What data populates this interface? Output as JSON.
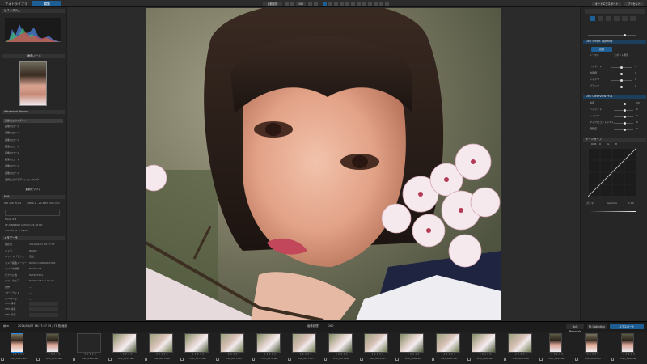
{
  "topbar": {
    "library_tab": "フォトライブラリ",
    "edit_tab": "編集",
    "compare_btn": "比較処理",
    "zoom_btn": "100",
    "sync_btn": "オートエクスポート",
    "right_btn": "プリセット"
  },
  "left": {
    "histogram_title": "ヒストグラム",
    "navigator_title": "画像ノート",
    "history_title": "Advanced History",
    "history_items": [
      "画像のエクスポート",
      "画像のロード",
      "画像のロード",
      "画像のロード",
      "画像のロード",
      "画像のロード",
      "画像のロード",
      "画像のロード",
      "画像のロード",
      "選択先のグラデーションマスク"
    ],
    "restore_btn": "最新をクリア",
    "exif_title": "Exif",
    "exif_top": [
      "ISO 100",
      "f/1.4",
      "1/800 s",
      "+0.3 EV",
      "105 mm"
    ],
    "exif_lines": [
      "Nikon Z 8",
      "AF-S NIKKOR 105mm f/1.4E ED",
      "ISO100 f/1.4 1/800s"
    ],
    "meta_title": "メタデータ",
    "meta_rows": [
      {
        "k": "撮影日",
        "v": "2024/04/07 16:17:57"
      },
      {
        "k": "カメラ",
        "v": "NIKON"
      },
      {
        "k": "ホワイトバランス",
        "v": "自動"
      },
      {
        "k": "カメラ製造メーカー",
        "v": "NIKON CORPORATION"
      },
      {
        "k": "カメラの種類",
        "v": "NIKON Z 8"
      },
      {
        "k": "ピクセル数",
        "v": "8256x5504"
      },
      {
        "k": "ソフトウェア",
        "v": "NIKON Z 8 Ver.02.00"
      },
      {
        "k": "著作",
        "v": "---"
      },
      {
        "k": "コピーライト",
        "v": "---"
      },
      {
        "k": "キーワード",
        "v": "---"
      }
    ],
    "iptc_rows": [
      "IPTC 情報",
      "IPTC 情報",
      "IPTC 情報"
    ],
    "bottom_label": "デフォルトに戻す"
  },
  "right": {
    "section1": "DxO Smart Lighting",
    "s1_mode": "自動",
    "s1_tab1": "ノーマル",
    "s1_tab2": "スポット測光",
    "s1_items": [
      {
        "label": "ハイライト",
        "value": "0"
      },
      {
        "label": "中間調",
        "value": "0"
      },
      {
        "label": "シャドウ",
        "value": "0"
      },
      {
        "label": "ブラック",
        "value": "0"
      }
    ],
    "section2": "DxO ClearView Plus",
    "s2_items": [
      {
        "label": "強度",
        "value": "50"
      },
      {
        "label": "ハイライト",
        "value": "0"
      },
      {
        "label": "シャドウ",
        "value": "0"
      },
      {
        "label": "マイクロコントラスト",
        "value": "0"
      },
      {
        "label": "明瞭度",
        "value": "0"
      }
    ],
    "curve_title": "トーンカーブ",
    "curve_options": [
      "RGB",
      "R",
      "G",
      "B"
    ],
    "bottom": [
      "ガンマ",
      "Gamma",
      "1.00"
    ]
  },
  "status": {
    "left_text": "2024/04/07 16:17:57 19 / 78 枚 画像",
    "center_text": "画像処理",
    "center_val": "DXO",
    "right_btn1": "DxO PhotoLab",
    "right_btn2": "Fit Collection",
    "export_btn": "エクスポート"
  },
  "filmstrip": {
    "thumbs": [
      {
        "name": "DSC_0105.NEF",
        "portrait": true
      },
      {
        "name": "DSC_0107.NEF",
        "portrait": true
      },
      {
        "name": "DSC_0109.NEF",
        "portrait": false,
        "blank": true
      },
      {
        "name": "DSC_0072.NEF",
        "portrait": false
      },
      {
        "name": "DSC_0073.NEF",
        "portrait": false
      },
      {
        "name": "DSC_0074.NEF",
        "portrait": false
      },
      {
        "name": "DSC_0075.NEF",
        "portrait": false
      },
      {
        "name": "DSC_0076.NEF",
        "portrait": false
      },
      {
        "name": "DSC_0077.NEF",
        "portrait": false
      },
      {
        "name": "DSC_0078.NEF",
        "portrait": false
      },
      {
        "name": "DSC_0079.NEF",
        "portrait": false
      },
      {
        "name": "DSC_0080.NEF",
        "portrait": false
      },
      {
        "name": "DSC_0081.NEF",
        "portrait": false
      },
      {
        "name": "DSC_0082.NEF",
        "portrait": false
      },
      {
        "name": "DSC_0083.NEF",
        "portrait": false
      },
      {
        "name": "DSC_0084.NEF",
        "portrait": true
      },
      {
        "name": "DSC_0085.NEF",
        "portrait": true
      },
      {
        "name": "DSC_0086.NEF",
        "portrait": true
      }
    ],
    "star_text": "★★★★★"
  }
}
